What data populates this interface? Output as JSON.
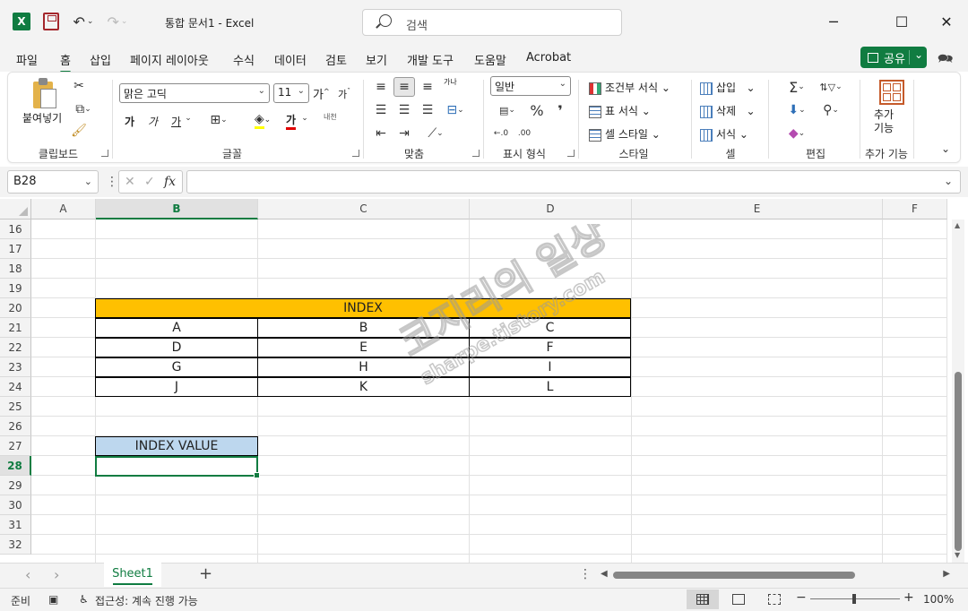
{
  "app": {
    "title": "통합 문서1  -  Excel"
  },
  "search": {
    "placeholder": "검색"
  },
  "menu": {
    "tabs": [
      "파일",
      "홈",
      "삽입",
      "페이지 레이아웃",
      "수식",
      "데이터",
      "검토",
      "보기",
      "개발 도구",
      "도움말",
      "Acrobat"
    ],
    "active": "홈",
    "share_label": "공유"
  },
  "ribbon": {
    "clipboard": {
      "paste": "붙여넣기",
      "label": "클립보드"
    },
    "font": {
      "name": "맑은 고딕",
      "size": "11",
      "grow": "가",
      "shrink": "가",
      "bold": "가",
      "italic": "가",
      "underline": "가",
      "color_letter": "가",
      "phonetic": "내천",
      "label": "글꼴"
    },
    "align": {
      "label": "맞춤",
      "wrap": "가나"
    },
    "number": {
      "format": "일반",
      "label": "표시 형식"
    },
    "styles": {
      "conditional": "조건부 서식",
      "table": "표 서식",
      "cell": "셀 스타일",
      "label": "스타일"
    },
    "cells": {
      "insert": "삽입",
      "delete": "삭제",
      "format": "서식",
      "label": "셀"
    },
    "editing": {
      "label": "편집"
    },
    "addins": {
      "button": "추가\n기능",
      "label": "추가 기능"
    }
  },
  "formula_bar": {
    "name_box": "B28",
    "fx": "fx",
    "value": ""
  },
  "columns": [
    "A",
    "B",
    "C",
    "D",
    "E",
    "F"
  ],
  "selected_column": "B",
  "rows": [
    "16",
    "17",
    "18",
    "19",
    "20",
    "21",
    "22",
    "23",
    "24",
    "25",
    "26",
    "27",
    "28",
    "29",
    "30",
    "31",
    "32"
  ],
  "selected_row": "28",
  "table": {
    "header": "INDEX",
    "cells": [
      [
        "A",
        "B",
        "C"
      ],
      [
        "D",
        "E",
        "F"
      ],
      [
        "G",
        "H",
        "I"
      ],
      [
        "J",
        "K",
        "L"
      ]
    ]
  },
  "index_value": {
    "header": "INDEX VALUE",
    "value": ""
  },
  "sheets": {
    "active": "Sheet1"
  },
  "status": {
    "ready": "준비",
    "accessibility": "접근성: 계속 진행 가능",
    "zoom": "100%"
  },
  "watermark": {
    "line1": "코지리의 일상",
    "line2": "sharpe.tistory.com"
  },
  "colors": {
    "excel_green": "#107c41",
    "index_header": "#ffc000",
    "index_value_header": "#bdd7ee"
  }
}
